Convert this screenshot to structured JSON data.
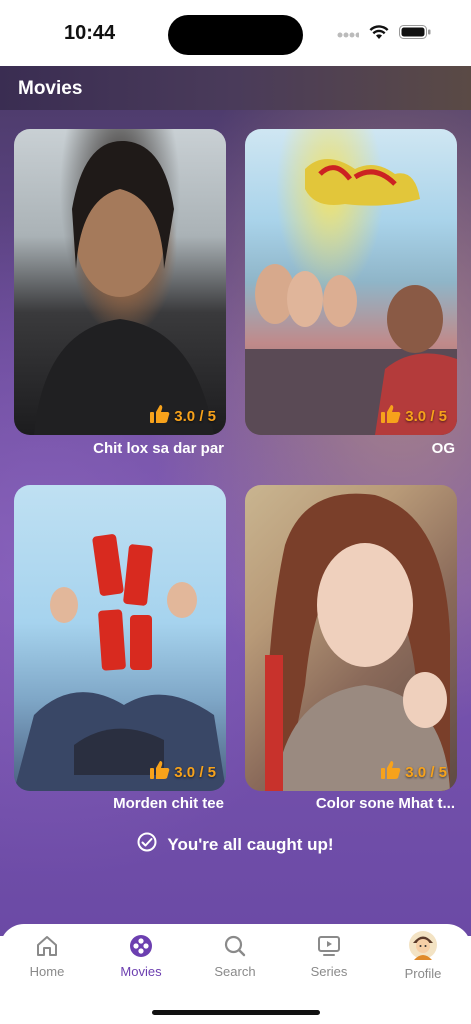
{
  "status_bar": {
    "time": "10:44"
  },
  "header": {
    "title": "Movies"
  },
  "movies": [
    {
      "title": "Chit lox sa dar par",
      "rating": "3.0 / 5"
    },
    {
      "title": "OG",
      "rating": "3.0 / 5"
    },
    {
      "title": "Morden chit tee",
      "rating": "3.0 / 5"
    },
    {
      "title": "Color sone Mhat  t...",
      "rating": "3.0 / 5"
    }
  ],
  "footer_message": "You're all caught up!",
  "tabbar": {
    "items": [
      {
        "label": "Home",
        "icon": "home-icon"
      },
      {
        "label": "Movies",
        "icon": "film-reel-icon"
      },
      {
        "label": "Search",
        "icon": "search-icon"
      },
      {
        "label": "Series",
        "icon": "tv-play-icon"
      },
      {
        "label": "Profile",
        "icon": "avatar-icon"
      }
    ],
    "active": "Movies"
  },
  "colors": {
    "accent": "#6c3fb0",
    "rating": "#f7a21b"
  }
}
